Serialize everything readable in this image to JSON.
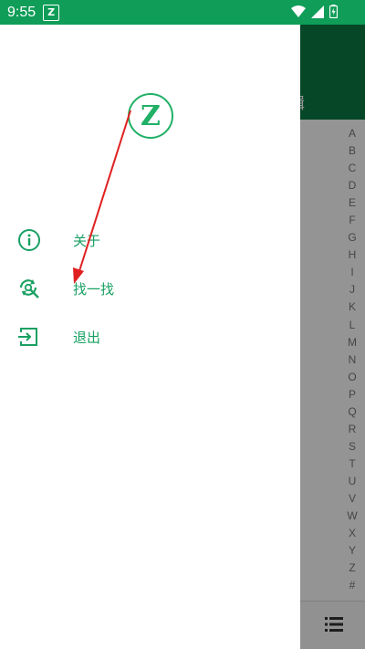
{
  "status_bar": {
    "time": "9:55",
    "app_icon_letter": "Z"
  },
  "background_app": {
    "header_title": "编辑",
    "alphabet_index": [
      "A",
      "B",
      "C",
      "D",
      "E",
      "F",
      "G",
      "H",
      "I",
      "J",
      "K",
      "L",
      "M",
      "N",
      "O",
      "P",
      "Q",
      "R",
      "S",
      "T",
      "U",
      "V",
      "W",
      "X",
      "Y",
      "Z",
      "#"
    ]
  },
  "drawer": {
    "logo_letter": "Z",
    "menu_items": [
      {
        "label": "关于",
        "icon": "info-icon"
      },
      {
        "label": "找一找",
        "icon": "search-refresh-icon"
      },
      {
        "label": "退出",
        "icon": "exit-icon"
      }
    ]
  },
  "colors": {
    "status_bar": "#0f9d58",
    "accent": "#18a062",
    "annotation_arrow": "#e02020"
  }
}
